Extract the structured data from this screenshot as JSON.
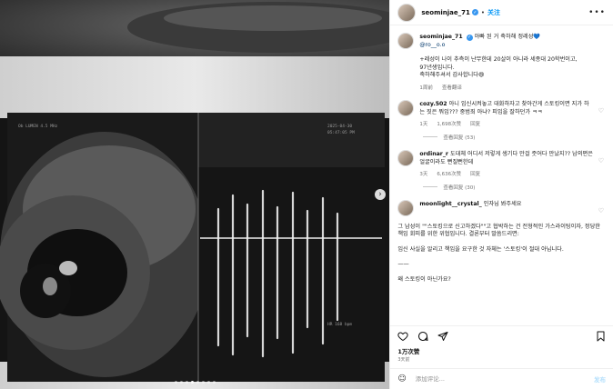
{
  "author": {
    "username": "seominjae_71",
    "follow_label": "关注"
  },
  "caption": {
    "line1": "아빠 된 거 축하해 정레성",
    "mention": "@ro__o.o",
    "body": [
      "+레성이 나이 추측이 난무한데 20살이 아니라 세종대 20학번이고,",
      "97년생입니다.",
      "축하해주셔서 감사합니다😄"
    ],
    "time": "1周前",
    "translate": "查看翻译"
  },
  "comments": [
    {
      "user": "cozy.502",
      "text": "아니 임신시켜놓고 대화하자고 찾아간게 스토킹이면 지가 하는 짓은 뭐임??? 중범죄 아냐? 피임을 잘하던가 ㅋㅋ",
      "time": "1天",
      "likes": "1,698次赞",
      "reply": "回复",
      "view_replies": "查看回复 (53)"
    },
    {
      "user": "ordinar_r",
      "text": "도대체 어디서 저렇게 생기다 만걸 줏어다 만났지?? 남의편은 얼굴이라도 뻔질뻔한데",
      "time": "3天",
      "likes": "6,636次赞",
      "reply": "回复",
      "view_replies": "查看回复 (30)"
    },
    {
      "user": "moonlight__crystal_",
      "text": "인자님 봐주세요",
      "paragraphs": [
        "그 남성이 \"\"스토킹으로 신고하겠다\"\"고 협박하는 건 전형적인 가스라이팅이자, 정당한 책임 회피를 위한 위협입니다. 결론부터 말씀드리면:",
        "임신 사실을 알리고 책임을 요구한 것 자체는 '스토킹'이 절대 아닙니다.",
        "——",
        "왜 스토킹이 아닌가요?"
      ]
    }
  ],
  "likes_label": "1万次赞",
  "post_date": "3天前",
  "comment_input": {
    "placeholder": "添加评论...",
    "post_label": "发布"
  },
  "icons": [
    "more-icon",
    "heart-icon",
    "comment-icon",
    "share-icon",
    "bookmark-icon",
    "emoji-icon",
    "next-icon"
  ],
  "colors": {
    "accent": "#0095f6",
    "verified": "#3897f0"
  }
}
